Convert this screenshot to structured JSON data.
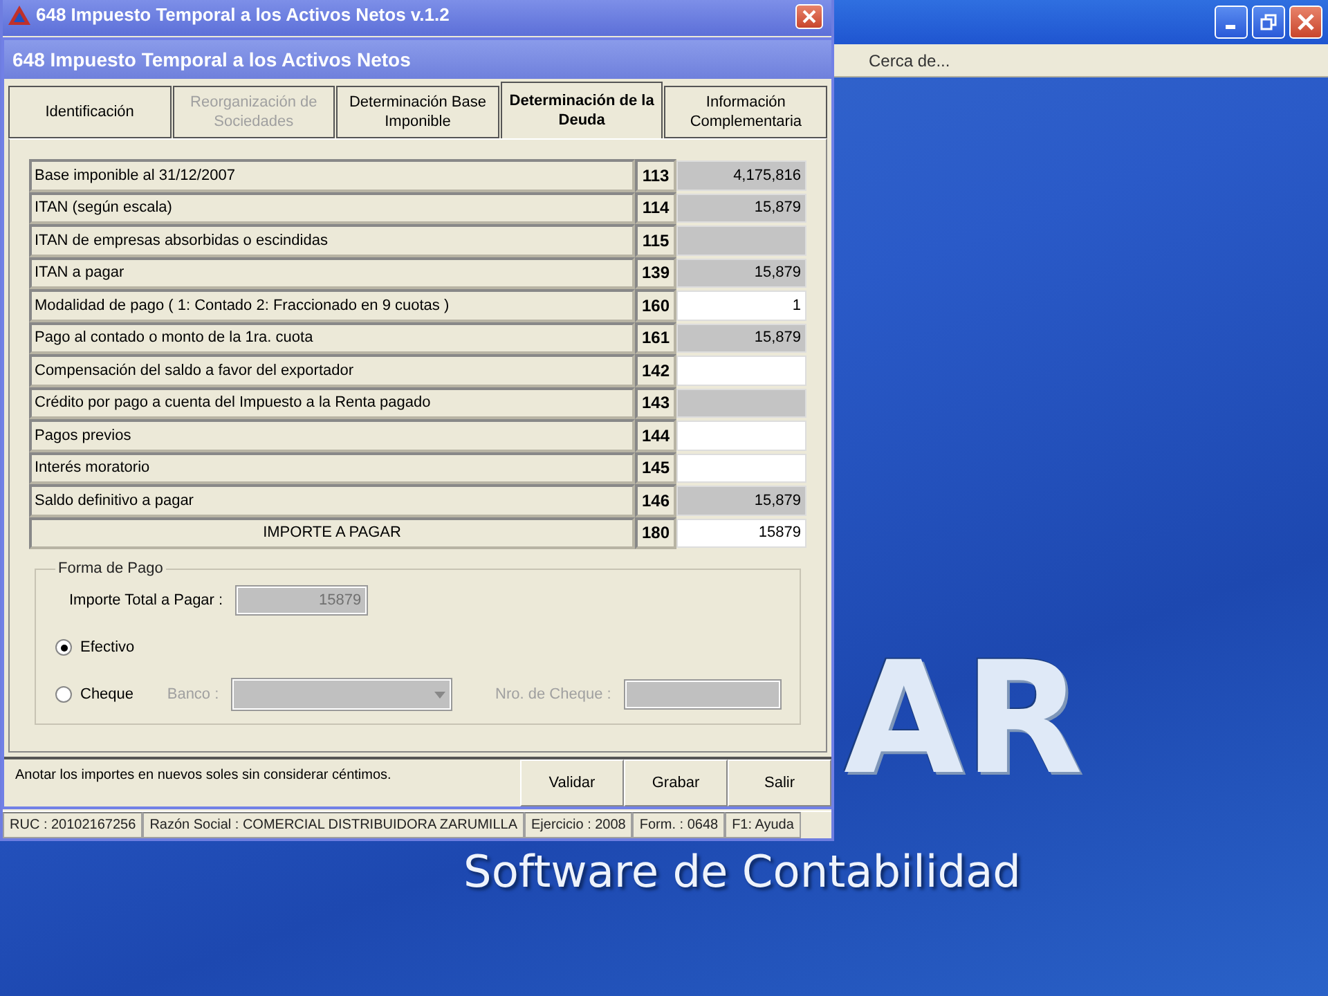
{
  "desktop": {
    "logo": "AR",
    "tagline": "Software de Contabilidad"
  },
  "app": {
    "menu": [
      "Cerca de..."
    ]
  },
  "child_window": {
    "title": "648 Impuesto Temporal a los Activos Netos  v.1.2",
    "status_bar": [
      "RUC : 20102167256",
      "Razón Social : COMERCIAL DISTRIBUIDORA ZARUMILLA",
      "Ejercicio : 2008",
      "Form. : 0648",
      "F1: Ayuda"
    ]
  },
  "dialog": {
    "title": "648 Impuesto Temporal a los Activos Netos",
    "tabs": [
      {
        "label": "Identificación",
        "selected": false,
        "disabled": false
      },
      {
        "label": "Reorganización de Sociedades",
        "selected": false,
        "disabled": true
      },
      {
        "label": "Determinación Base Imponible",
        "selected": false,
        "disabled": false
      },
      {
        "label": "Determinación de la Deuda",
        "selected": true,
        "disabled": false
      },
      {
        "label": "Información Complementaria",
        "selected": false,
        "disabled": false
      }
    ],
    "rows": [
      {
        "kind": "line",
        "label": "Base imponible al 31/12/2007",
        "code": "113",
        "value": "4,175,816",
        "editable": false
      },
      {
        "kind": "line",
        "label": "ITAN (según escala)",
        "code": "114",
        "value": "15,879",
        "editable": false
      },
      {
        "kind": "line",
        "label": "ITAN de empresas absorbidas o escindidas",
        "code": "115",
        "editable": false
      },
      {
        "kind": "line",
        "label": "ITAN a pagar",
        "code": "139",
        "value": "15,879",
        "editable": false
      },
      {
        "kind": "line",
        "label": "Modalidad de pago   ( 1: Contado    2:  Fraccionado en 9 cuotas )",
        "code": "160",
        "value": "1",
        "editable": true
      },
      {
        "kind": "line",
        "label": "Pago al contado o monto de la 1ra. cuota",
        "code": "161",
        "value": "15,879",
        "editable": false
      },
      {
        "kind": "line",
        "label": "Compensación del saldo a favor del exportador",
        "code": "142",
        "editable": true
      },
      {
        "kind": "line",
        "label": "Crédito por pago a cuenta del Impuesto a la Renta pagado",
        "code": "143",
        "editable": false
      },
      {
        "kind": "line",
        "label": "Pagos previos",
        "code": "144",
        "editable": true
      },
      {
        "kind": "line",
        "label": "Interés moratorio",
        "code": "145",
        "editable": true
      },
      {
        "kind": "line",
        "label": "Saldo definitivo a pagar",
        "code": "146",
        "value": "15,879",
        "editable": false
      },
      {
        "kind": "total",
        "label": "IMPORTE A PAGAR",
        "code": "180",
        "value": "15879",
        "editable": true
      }
    ],
    "payment": {
      "legend": "Forma de Pago",
      "total_label": "Importe Total a Pagar :",
      "total_value": "15879",
      "options": [
        {
          "label": "Efectivo",
          "selected": true
        },
        {
          "label": "Cheque",
          "selected": false
        }
      ],
      "bank_label": "Banco :",
      "cheque_label": "Nro. de Cheque :"
    },
    "note": "Anotar los importes en nuevos soles sin considerar céntimos.",
    "buttons": [
      "Validar",
      "Grabar",
      "Salir"
    ]
  }
}
